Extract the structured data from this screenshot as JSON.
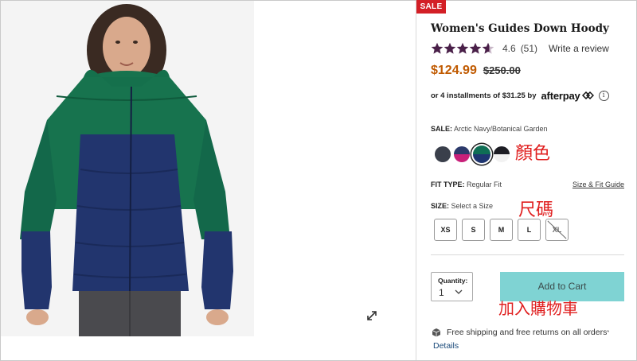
{
  "badge": {
    "sale_label": "SALE"
  },
  "product": {
    "title": "Women's Guides Down Hoody",
    "rating_value": "4.6",
    "rating_stars": 4.6,
    "rating_count": "(51)",
    "write_review_label": "Write a review"
  },
  "price": {
    "sale": "$124.99",
    "original": "$250.00"
  },
  "afterpay": {
    "text": "or 4 installments of $31.25 by",
    "logo": "afterpay",
    "info_icon": "i"
  },
  "color": {
    "prefix": "SALE:",
    "selected": "Arctic Navy/Botanical Garden",
    "swatches": [
      {
        "name": "dark-slate",
        "colors": [
          "#3a3f4b",
          "#3a3f4b"
        ]
      },
      {
        "name": "navy-magenta",
        "colors": [
          "#2c3a6b",
          "#c8207a"
        ]
      },
      {
        "name": "arctic-navy-botanical-garden",
        "colors": [
          "#0f6e55",
          "#1e3570"
        ],
        "selected": true
      },
      {
        "name": "black-white",
        "colors": [
          "#1d1d24",
          "#f2f2f2"
        ]
      }
    ]
  },
  "fit": {
    "prefix": "FIT TYPE:",
    "value": "Regular Fit",
    "guide_link": "Size & Fit Guide"
  },
  "size": {
    "prefix": "SIZE:",
    "value": "Select a Size",
    "options": [
      {
        "label": "XS",
        "available": true
      },
      {
        "label": "S",
        "available": true
      },
      {
        "label": "M",
        "available": true
      },
      {
        "label": "L",
        "available": true
      },
      {
        "label": "XL",
        "available": false
      }
    ]
  },
  "quantity": {
    "label": "Quantity:",
    "value": "1"
  },
  "cart": {
    "add_label": "Add to Cart"
  },
  "shipping": {
    "text": "Free shipping and free returns on all orders",
    "mark": "*",
    "details_link": "Details"
  },
  "annotations": {
    "color": "顏色",
    "size": "尺碼",
    "cart": "加入購物車"
  },
  "icons": {
    "star": "star-icon",
    "expand": "expand-icon",
    "info": "info-icon",
    "chevron": "chevron-down-icon",
    "box": "box-icon"
  },
  "colors": {
    "sale_badge": "#d31f26",
    "sale_price": "#c05a00",
    "star": "#4a2049",
    "add_to_cart": "#7fd3d3",
    "annotation": "#e02020"
  }
}
